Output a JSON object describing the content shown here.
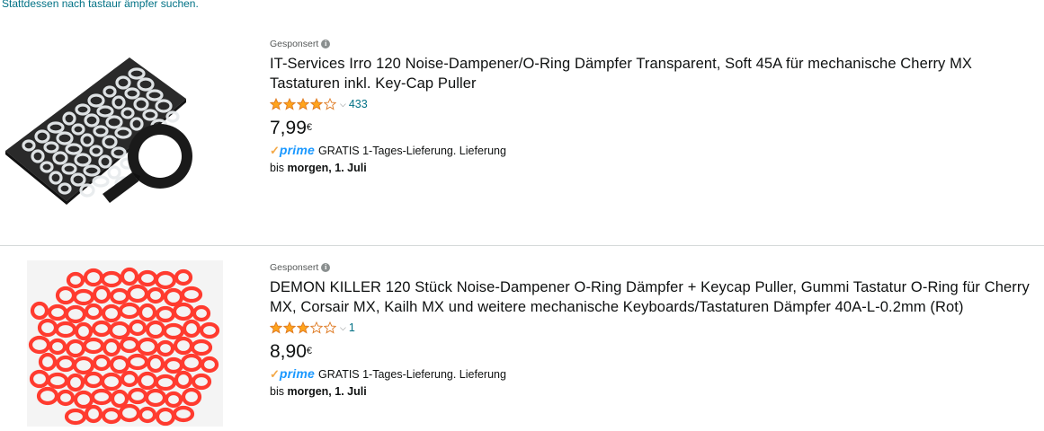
{
  "suggestion": "Stattdessen nach tastaur ämpfer suchen.",
  "results": [
    {
      "sponsored_label": "Gesponsert",
      "title": "IT-Services Irro 120 Noise-Dampener/O-Ring Dämpfer Transparent, Soft 45A für mechanische Cherry MX Tastaturen inkl. Key-Cap Puller",
      "rating": 4.0,
      "review_count": "433",
      "price_whole": "7,99",
      "price_currency": "€",
      "prime_label": "prime",
      "shipping_text": "GRATIS 1-Tages-Lieferung. Lieferung",
      "delivery_prefix": "bis",
      "delivery_date": "morgen, 1. Juli",
      "image": "clear-o-rings-with-keycap-puller"
    },
    {
      "sponsored_label": "Gesponsert",
      "title": "DEMON KILLER 120 Stück Noise-Dampener O-Ring Dämpfer + Keycap Puller, Gummi Tastatur O-Ring für Cherry MX, Corsair MX, Kailh MX und weitere mechanische Keyboards/Tastaturen Dämpfer 40A-L-0.2mm (Rot)",
      "rating": 3.0,
      "review_count": "1",
      "price_whole": "8,90",
      "price_currency": "€",
      "prime_label": "prime",
      "shipping_text": "GRATIS 1-Tages-Lieferung. Lieferung",
      "delivery_prefix": "bis",
      "delivery_date": "morgen, 1. Juli",
      "image": "red-o-rings"
    }
  ],
  "colors": {
    "link": "#007185",
    "star": "#ffa41c",
    "prime": "#1a98ff",
    "prime_check": "#f3a847"
  }
}
